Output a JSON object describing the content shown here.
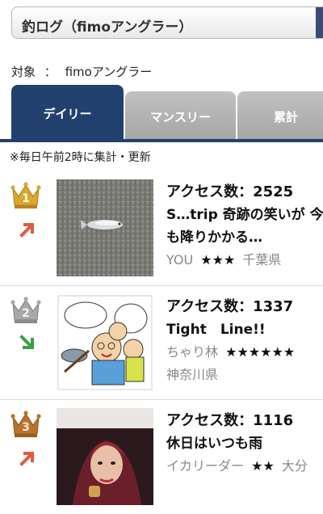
{
  "header": {
    "title": "釣ログ（fimoアングラー）"
  },
  "target": {
    "label": "対象",
    "separator": "：",
    "value": "fimoアングラー"
  },
  "tabs": [
    {
      "label": "デイリー",
      "active": true
    },
    {
      "label": "マンスリー",
      "active": false
    },
    {
      "label": "累計",
      "active": false
    }
  ],
  "note": "※毎日午前2時に集計・更新",
  "ranking": [
    {
      "rank": "1",
      "trend": "up",
      "access": "アクセス数：2525",
      "title_line1": "S…trip 奇跡の笑いが 今",
      "title_line2": "も降りかかる…",
      "user": "YOU",
      "stars": "★★★",
      "location": "千葉県"
    },
    {
      "rank": "2",
      "trend": "down",
      "access": "アクセス数：1337",
      "title_line1": "Tight　Line!!",
      "user": "ちゃり林",
      "stars": "★★★★★★",
      "location": "神奈川県"
    },
    {
      "rank": "3",
      "trend": "up",
      "access": "アクセス数：1116",
      "title_line1": "休日はいつも雨",
      "user": "イカリーダー",
      "stars": "★★",
      "location": "大分"
    }
  ],
  "colors": {
    "tab_active": "#22406e",
    "gold": "#c9962a",
    "silver": "#9a9a9a",
    "bronze": "#b06a2a",
    "arrow": "#e15a3e"
  }
}
